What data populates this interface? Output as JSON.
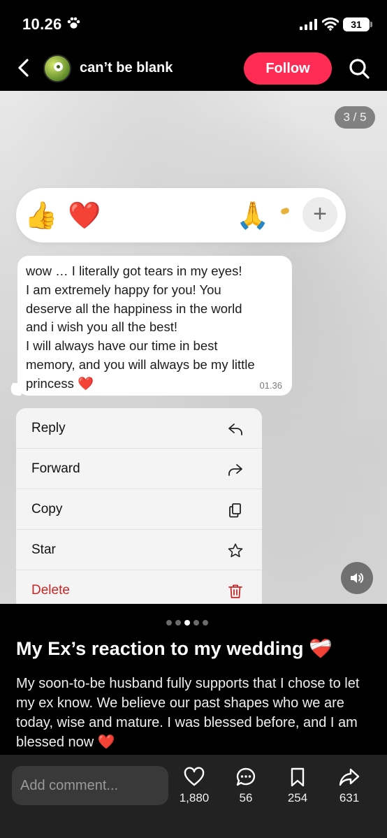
{
  "status_bar": {
    "time": "10.26",
    "battery": "31"
  },
  "header": {
    "username": "can’t be blank",
    "follow_label": "Follow"
  },
  "media": {
    "page_indicator": "3 / 5",
    "reactions": [
      "👍",
      "❤️",
      "😂",
      "😮",
      "😢",
      "🙏"
    ],
    "add_reaction": "+",
    "message": {
      "text": "wow … I literally got tears in my eyes!\nI am extremely happy for you! You\ndeserve all the happiness in the world\nand i wish you all the best!\nI will always have our time in best\nmemory, and you will always be my little\nprincess",
      "heart": "❤️",
      "time": "01.36"
    },
    "context_menu": [
      {
        "label": "Reply",
        "icon": "reply-icon"
      },
      {
        "label": "Forward",
        "icon": "forward-icon"
      },
      {
        "label": "Copy",
        "icon": "copy-icon"
      },
      {
        "label": "Star",
        "icon": "star-icon"
      },
      {
        "label": "Delete",
        "icon": "trash-icon"
      }
    ]
  },
  "post": {
    "title": "My Ex’s reaction to my wedding",
    "title_emoji": "❤️‍🩹",
    "body": "My soon-to-be husband fully supports that I chose to let my ex know. We believe our past shapes who we are today, wise and mature. I was blessed before, and I am blessed now",
    "body_heart": "❤️",
    "carousel_dots": 5,
    "carousel_active": 3
  },
  "bottom_bar": {
    "comment_placeholder": "Add comment...",
    "likes": "1,880",
    "comments": "56",
    "saves": "254",
    "shares": "631"
  },
  "colors": {
    "accent": "#fe2c55",
    "delete": "#c62828",
    "heart": "#e8112d"
  }
}
